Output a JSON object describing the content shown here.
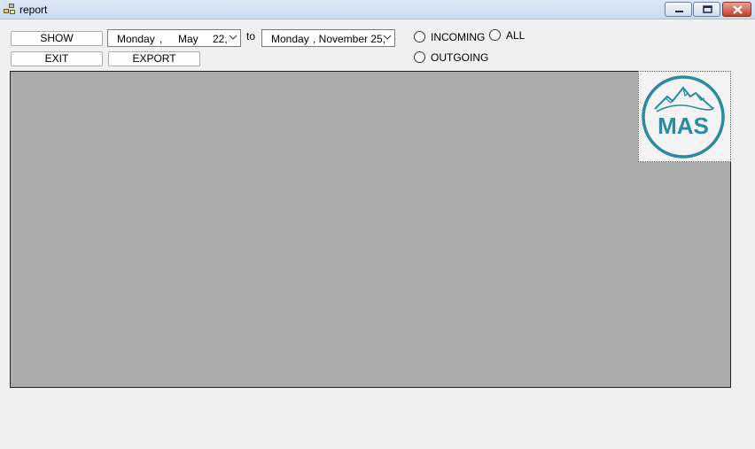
{
  "window": {
    "title": "report"
  },
  "toolbar": {
    "show_label": "SHOW",
    "exit_label": "EXIT",
    "export_label": "EXPORT",
    "date_from": {
      "day_name": "Monday",
      "sep": ",",
      "month": "May",
      "day": "22,"
    },
    "to_label": "to",
    "date_to": {
      "day_name": "Monday",
      "rest": ", November 25,"
    }
  },
  "filters": {
    "incoming_label": "INCOMING",
    "all_label": "ALL",
    "outgoing_label": "OUTGOING"
  },
  "logo": {
    "text": "MAS",
    "color": "#2b8aa0"
  },
  "colors": {
    "panel": "#ababab",
    "background": "#f0f0f0"
  }
}
